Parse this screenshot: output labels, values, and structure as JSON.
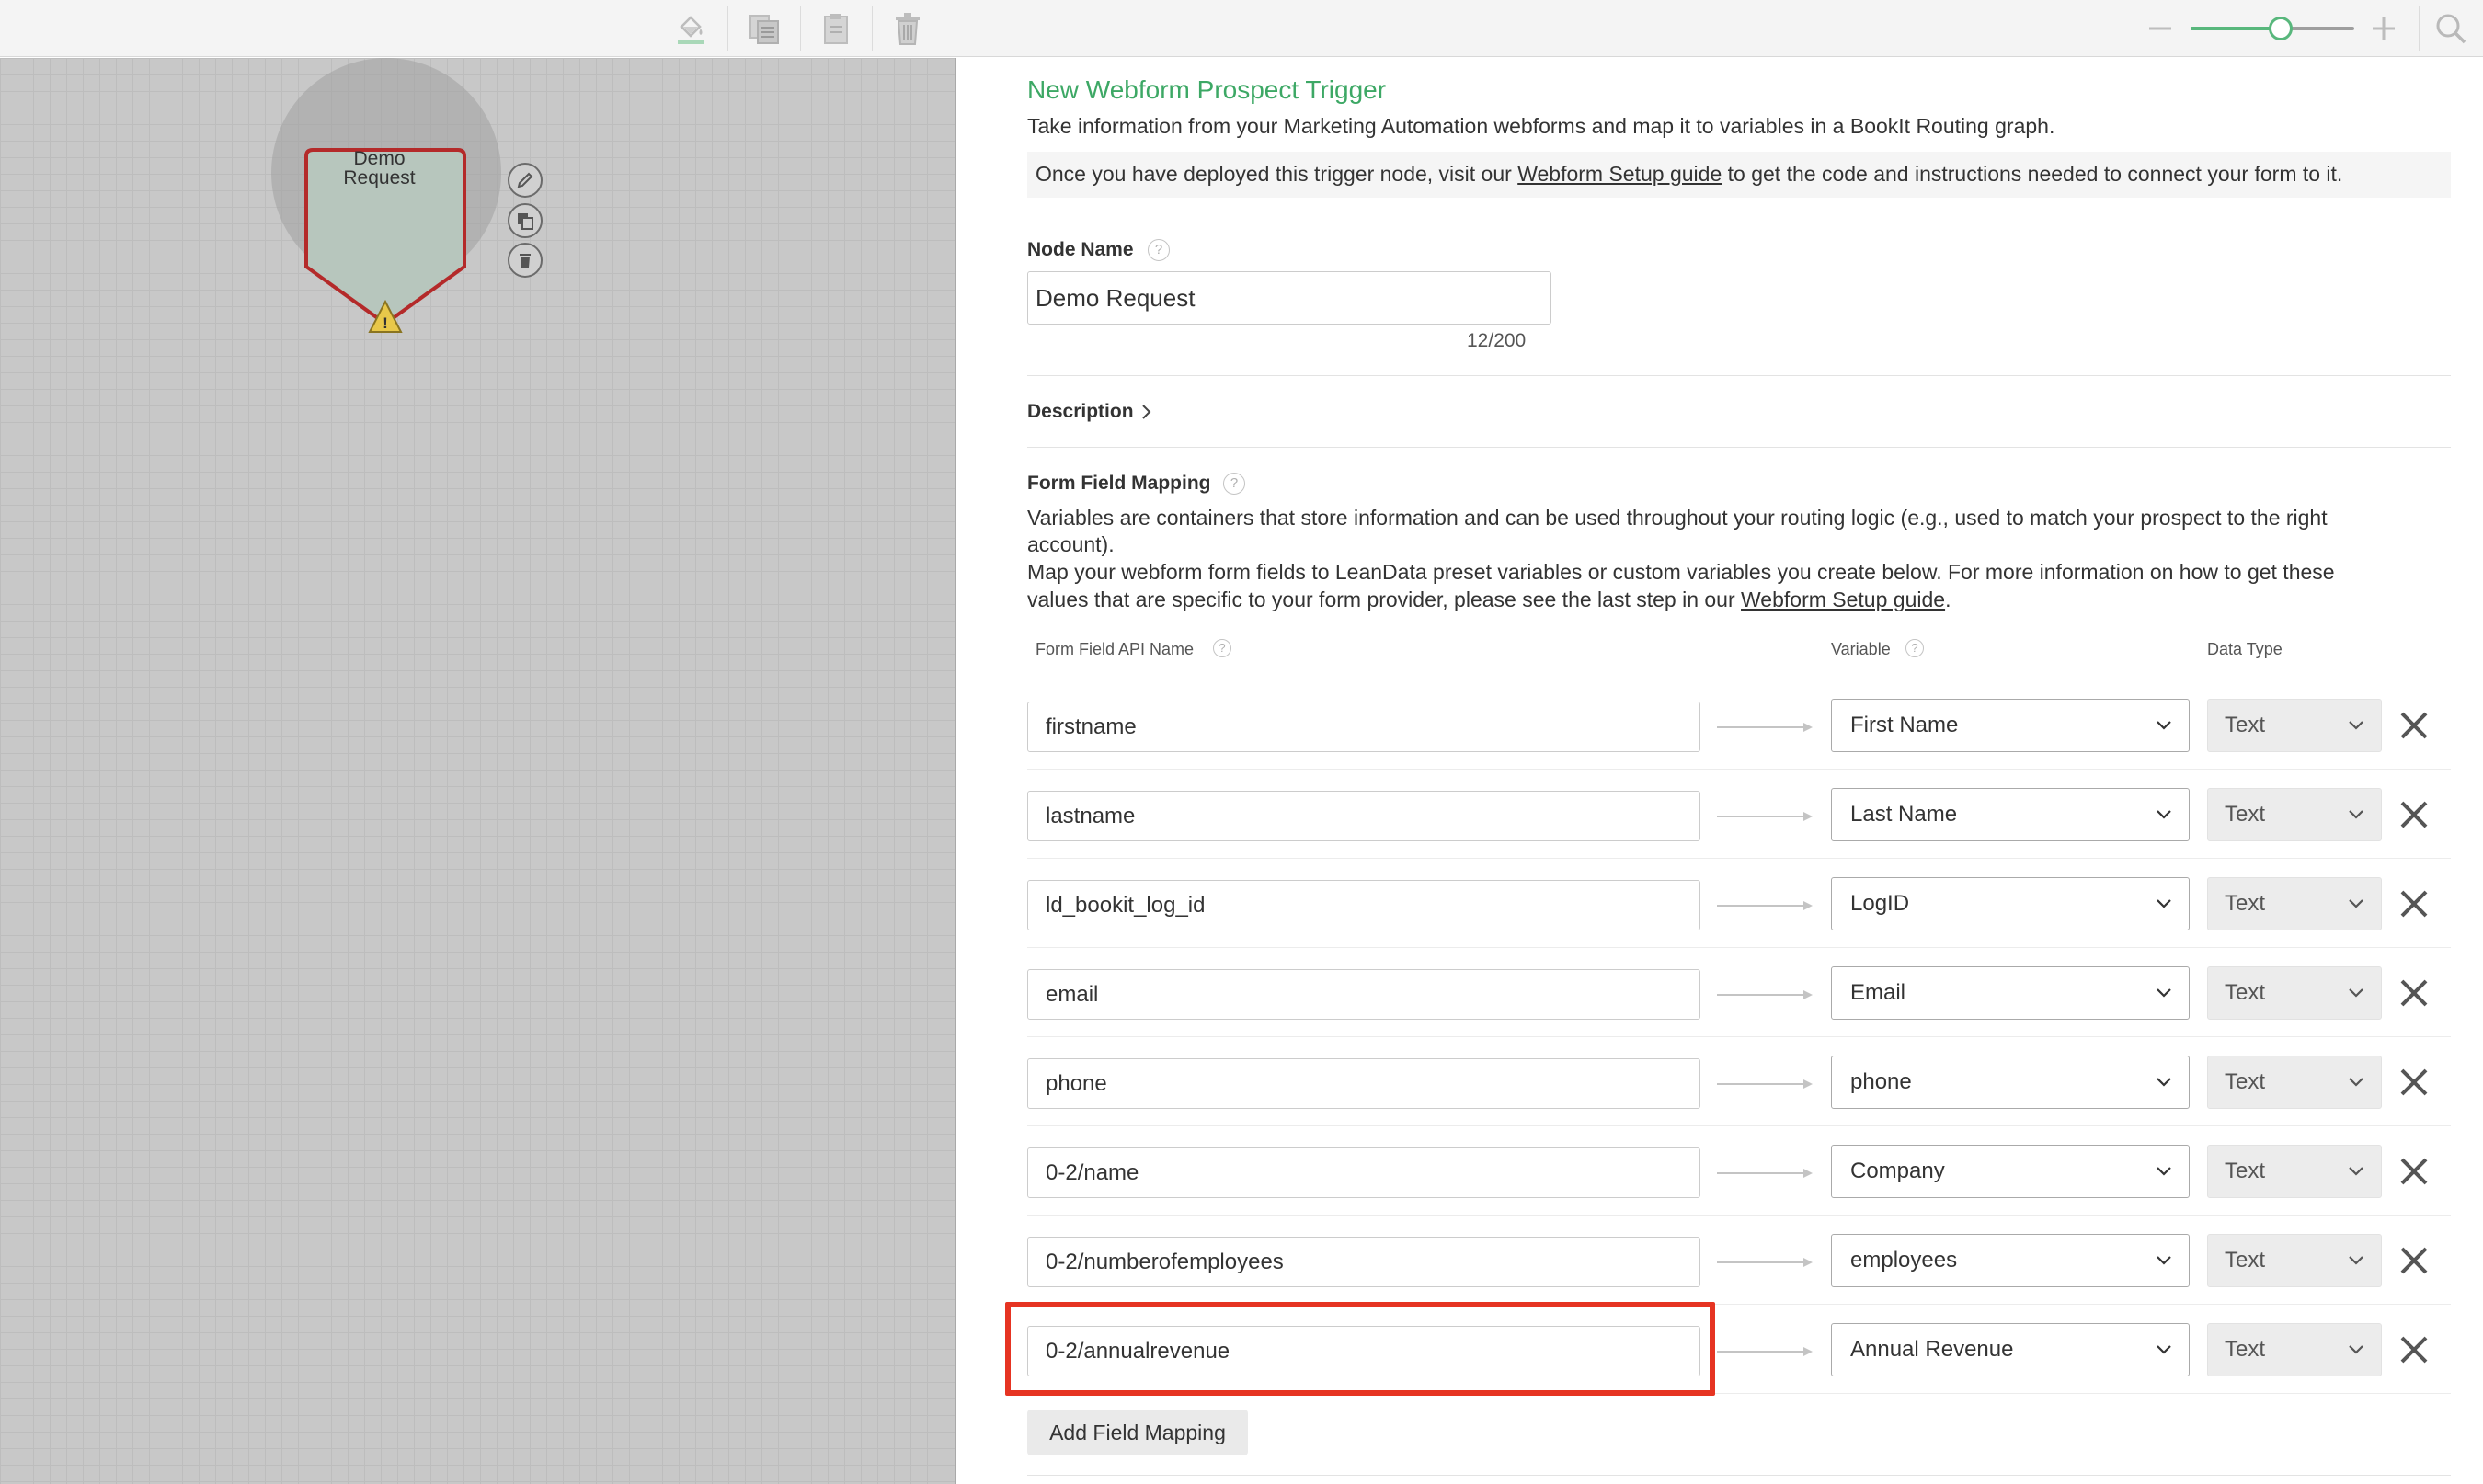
{
  "toolbar": {
    "icons": [
      "paint-bucket-icon",
      "copy-icon",
      "paste-icon",
      "trash-icon",
      "zoom-out-icon",
      "zoom-in-icon",
      "search-icon"
    ],
    "zoom_level_fraction": 0.55
  },
  "canvas": {
    "node": {
      "label_line1": "Demo",
      "label_line2": "Request",
      "warning_glyph": "!",
      "actions": [
        "edit-icon",
        "copy-icon",
        "delete-icon"
      ]
    }
  },
  "panel": {
    "title": "New Webform Prospect Trigger",
    "subtitle": "Take information from your Marketing Automation webforms and map it to variables in a BookIt Routing graph.",
    "info": {
      "before": "Once you have deployed this trigger node, visit our ",
      "link": "Webform Setup guide",
      "after": " to get the code and instructions needed to connect your form to it."
    },
    "node_name": {
      "label": "Node Name",
      "value": "Demo Request",
      "counter": "12/200"
    },
    "description": {
      "label": "Description"
    },
    "mapping": {
      "label": "Form Field Mapping",
      "desc_line1": "Variables are containers that store information and can be used throughout your routing logic (e.g., used to match your prospect to the right",
      "desc_line2": "account).",
      "desc_line3": "Map your webform form fields to LeanData preset variables or custom variables you create below. For more information on how to get these",
      "desc_line4_before": "values that are specific to your form provider, please see the last step in our ",
      "desc_line4_link": "Webform Setup guide",
      "desc_line4_after": ".",
      "col_api": "Form Field API Name",
      "col_variable": "Variable",
      "col_type": "Data Type",
      "rows": [
        {
          "field": "firstname",
          "variable": "First Name",
          "type": "Text"
        },
        {
          "field": "lastname",
          "variable": "Last Name",
          "type": "Text"
        },
        {
          "field": "ld_bookit_log_id",
          "variable": "LogID",
          "type": "Text"
        },
        {
          "field": "email",
          "variable": "Email",
          "type": "Text"
        },
        {
          "field": "phone",
          "variable": "phone",
          "type": "Text"
        },
        {
          "field": "0-2/name",
          "variable": "Company",
          "type": "Text"
        },
        {
          "field": "0-2/numberofemployees",
          "variable": "employees",
          "type": "Text"
        },
        {
          "field": "0-2/annualrevenue",
          "variable": "Annual Revenue",
          "type": "Text"
        }
      ],
      "add_button": "Add Field Mapping"
    }
  },
  "colors": {
    "accent_green": "#3da865",
    "highlight_red": "#e63422",
    "node_fill": "#b7c6bd",
    "node_border": "#b42a2a",
    "warning_yellow": "#e8c84a"
  }
}
